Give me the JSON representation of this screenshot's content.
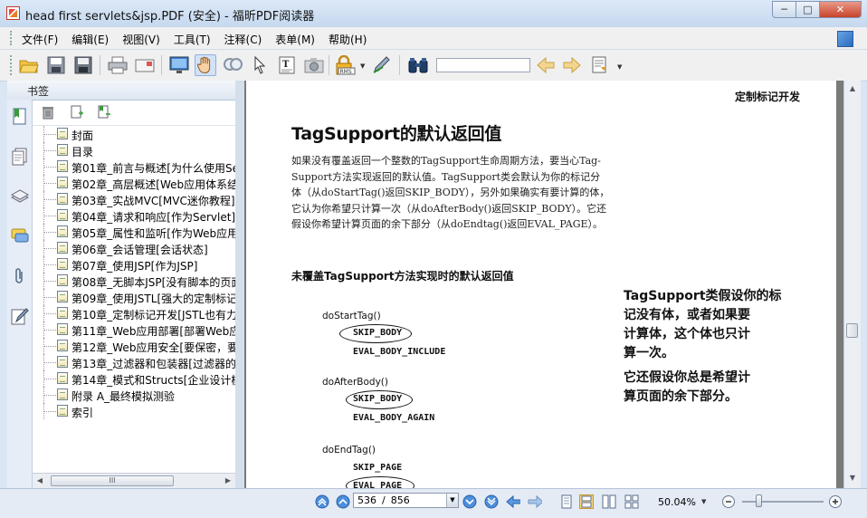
{
  "window": {
    "title": "head first servlets&jsp.PDF (安全) - 福昕PDF阅读器",
    "min_label": "─",
    "max_label": "□",
    "close_label": "✕"
  },
  "menu": [
    "文件(F)",
    "编辑(E)",
    "视图(V)",
    "工具(T)",
    "注释(C)",
    "表单(M)",
    "帮助(H)"
  ],
  "toolbar": {
    "rms_label": "RMS",
    "find_value": ""
  },
  "bookmarks": {
    "header": "书签",
    "items": [
      "封面",
      "目录",
      "第01章_前言与概述[为什么使用Se",
      "第02章_高层概述[Web应用体系结",
      "第03章_实战MVC[MVC迷你教程]",
      "第04章_请求和响应[作为Servlet]",
      "第05章_属性和监听[作为Web应用",
      "第06章_会话管理[会话状态]",
      "第07章_使用JSP[作为JSP]",
      "第08章_无脚本JSP[没有脚本的页面",
      "第09章_使用JSTL[强大的定制标记",
      "第10章_定制标记开发[JSTL也有力",
      "第11章_Web应用部署[部署Web应",
      "第12章_Web应用安全[要保密，要",
      "第13章_过滤器和包装器[过滤器的",
      "第14章_模式和Structs[企业设计模",
      "附录 A_最终模拟测验",
      "索引"
    ],
    "hscroll_grip": "III"
  },
  "document": {
    "running_header": "定制标记开发",
    "heading": "TagSupport的默认返回值",
    "paragraph_lines": [
      "如果没有覆盖返回一个整数的TagSupport生命周期方法，要当心Tag-",
      "Support方法实现返回的默认值。TagSupport类会默认为你的标记分",
      "体（从doStartTag()返回SKIP_BODY），另外如果确实有要计算的体，",
      "它认为你希望只计算一次（从doAfterBody()返回SKIP_BODY）。它还",
      "假设你希望计算页面的余下部分（从doEndtag()返回EVAL_PAGE）。"
    ],
    "subheading": "未覆盖TagSupport方法实现时的默认返回值",
    "code": {
      "start_tag": "doStartTag()",
      "start_skip": "SKIP_BODY",
      "start_eval": "EVAL_BODY_INCLUDE",
      "after_body": "doAfterBody()",
      "after_skip": "SKIP_BODY",
      "after_eval": "EVAL_BODY_AGAIN",
      "end_tag": "doEndTag()",
      "end_skip": "SKIP_PAGE",
      "end_eval": "EVAL_PAGE"
    },
    "note1_lines": [
      "TagSupport类假设你的标",
      "记没有体，或者如果要",
      "计算体，这个体也只计",
      "算一次。"
    ],
    "note2_lines": [
      "它还假设你总是希望计",
      "算页面的余下部分。"
    ]
  },
  "status": {
    "current_page": "536",
    "separator": "/",
    "total_pages": "856",
    "zoom": "50.04%"
  },
  "colors": {
    "accent": "#2b6bc0",
    "title_bg": "#dce9f8",
    "close_red": "#c7432a"
  }
}
